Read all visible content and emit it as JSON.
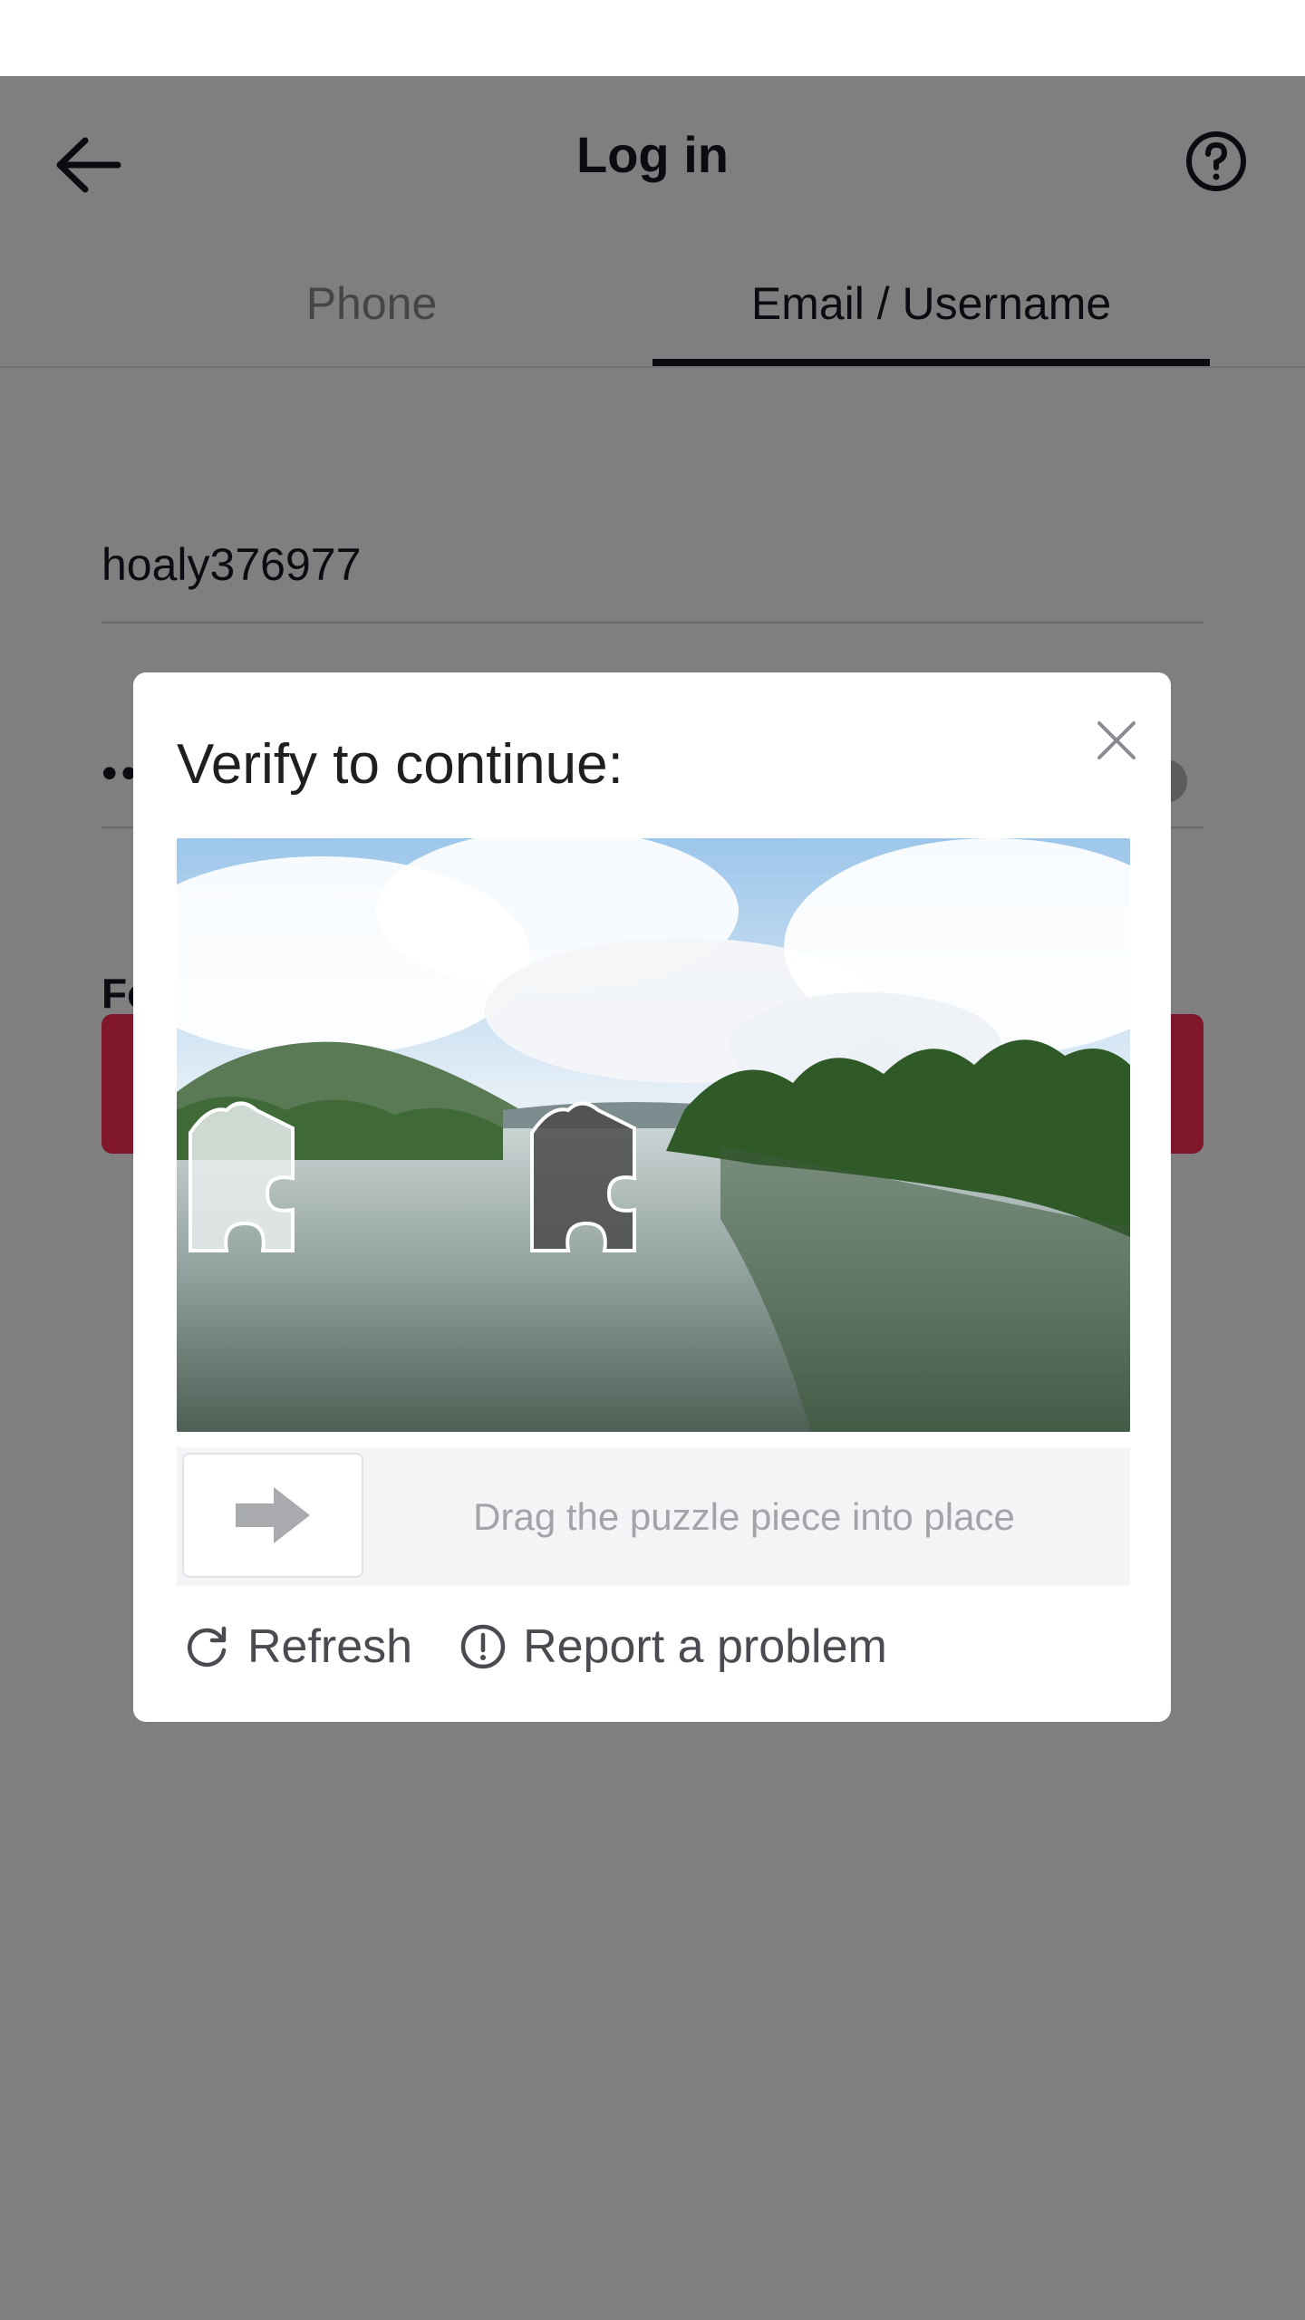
{
  "header": {
    "title": "Log in",
    "back_icon": "arrow-left-icon",
    "help_icon": "question-circle-icon"
  },
  "tabs": [
    {
      "label": "Phone",
      "active": false
    },
    {
      "label": "Email / Username",
      "active": true
    }
  ],
  "form": {
    "username_value": "hoaly376977",
    "password_value": "••",
    "forgot_label": "Fo",
    "login_button_color": "#fe2c55"
  },
  "captcha": {
    "title": "Verify to continue:",
    "close_icon": "close-icon",
    "image_icon": "landscape-river-photo",
    "slider_hint": "Drag the puzzle piece into place",
    "slider_icon": "arrow-right-icon",
    "refresh_label": "Refresh",
    "refresh_icon": "refresh-icon",
    "report_label": "Report a problem",
    "report_icon": "exclamation-circle-icon"
  }
}
